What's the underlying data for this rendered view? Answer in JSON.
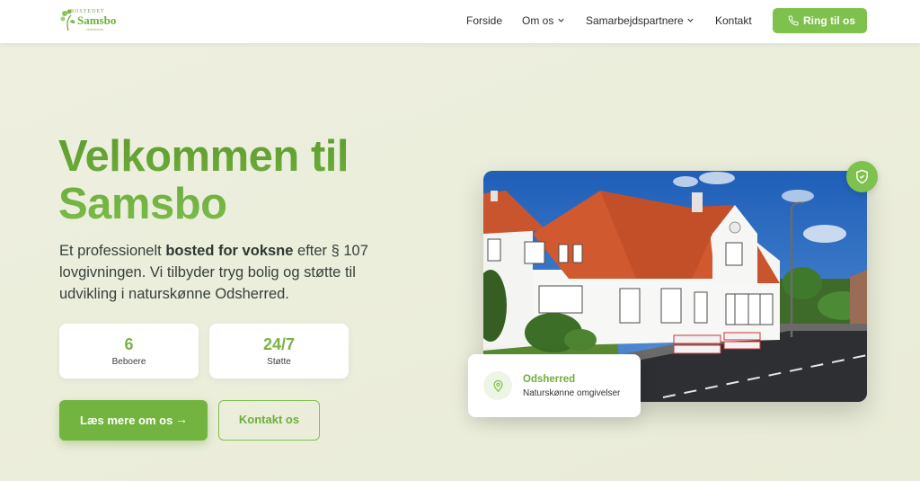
{
  "logo": {
    "top_text": "BOSTEDET",
    "name": "Samsbo",
    "sub_text": "Odsherred"
  },
  "nav": {
    "items": [
      {
        "label": "Forside"
      },
      {
        "label": "Om os",
        "has_dropdown": true
      },
      {
        "label": "Samarbejdspartnere",
        "has_dropdown": true
      },
      {
        "label": "Kontakt"
      }
    ],
    "cta_label": "Ring til os",
    "cta_icon": "phone-icon"
  },
  "hero": {
    "title_line1": "Velkommen til",
    "title_line2": "Samsbo",
    "text_before": "Et professionelt ",
    "text_bold": "bosted for voksne",
    "text_after": " efter § 107 lovgivningen. Vi tilbyder tryg bolig og støtte til udvikling i naturskønne Odsherred."
  },
  "stats": [
    {
      "value": "6",
      "label": "Beboere"
    },
    {
      "value": "24/7",
      "label": "Støtte"
    }
  ],
  "buttons": {
    "primary_label": "Læs mere om os",
    "primary_arrow": "→",
    "secondary_label": "Kontakt os"
  },
  "location_card": {
    "title": "Odsherred",
    "subtitle": "Naturskønne omgivelser",
    "icon": "map-pin-icon"
  },
  "badge_icon": "shield-check-icon",
  "colors": {
    "accent": "#7ec14d",
    "accent_dark": "#6fae3c",
    "background": "#eceedc",
    "text": "#2c3a30"
  }
}
